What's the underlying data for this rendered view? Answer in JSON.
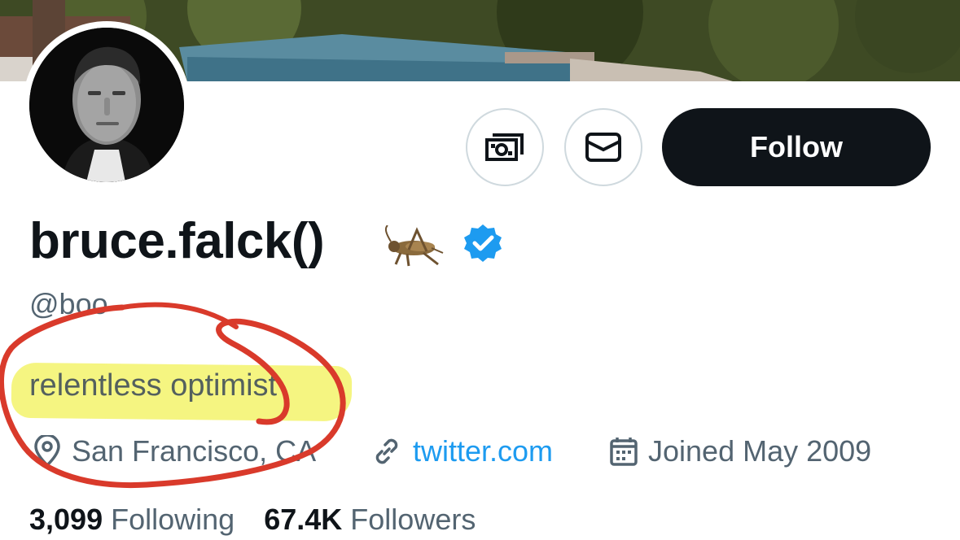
{
  "profile": {
    "display_name": "bruce.falck()",
    "name_emoji_icon": "cricket-icon",
    "verified_icon": "verified-badge-icon",
    "handle": "@boo",
    "bio": "relentless optimist",
    "location": "San Francisco, CA",
    "website": "twitter.com",
    "joined": "Joined May 2009"
  },
  "actions": {
    "tip_icon": "tip-money-icon",
    "message_icon": "envelope-icon",
    "follow_label": "Follow"
  },
  "stats": {
    "following_count": "3,099",
    "following_label": "Following",
    "followers_count": "67.4K",
    "followers_label": "Followers"
  },
  "colors": {
    "accent": "#1d9bf0",
    "verified": "#1d9bf0",
    "highlight": "#f4f47a",
    "annotation": "#d93a2b",
    "follow_bg": "#0f1419"
  }
}
